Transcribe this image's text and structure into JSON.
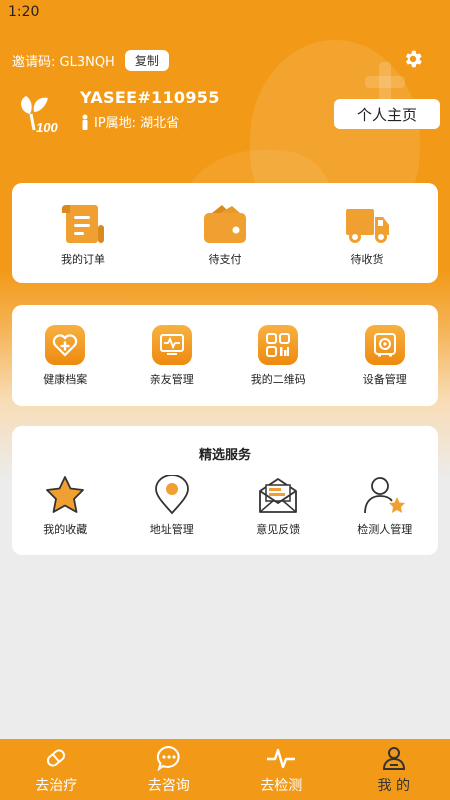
{
  "status_bar": {
    "time": "1:20"
  },
  "header": {
    "invite_code": "邀请码: GL3NQH",
    "copy_label": "复制",
    "username": "YASEE#110955",
    "ip_location": "IP属地: 湖北省",
    "homepage_label": "个人主页"
  },
  "orders": [
    {
      "label": "我的订单",
      "icon": "order-scroll-icon"
    },
    {
      "label": "待支付",
      "icon": "wallet-icon"
    },
    {
      "label": "待收货",
      "icon": "truck-icon"
    }
  ],
  "management": [
    {
      "label": "健康档案",
      "icon": "health-record-icon"
    },
    {
      "label": "亲友管理",
      "icon": "family-monitor-icon"
    },
    {
      "label": "我的二维码",
      "icon": "qr-code-icon"
    },
    {
      "label": "设备管理",
      "icon": "device-icon"
    }
  ],
  "services": {
    "title": "精选服务",
    "items": [
      {
        "label": "我的收藏",
        "icon": "star-icon"
      },
      {
        "label": "地址管理",
        "icon": "location-pin-icon"
      },
      {
        "label": "意见反馈",
        "icon": "feedback-envelope-icon"
      },
      {
        "label": "检测人管理",
        "icon": "tester-person-icon"
      }
    ]
  },
  "tabbar": [
    {
      "label": "去治疗",
      "icon": "pill-icon"
    },
    {
      "label": "去咨询",
      "icon": "chat-icon"
    },
    {
      "label": "去检测",
      "icon": "pulse-icon"
    },
    {
      "label": "我 的",
      "icon": "person-icon",
      "active": true
    }
  ],
  "colors": {
    "accent": "#f29a17",
    "icon_orange": "#f0a030",
    "background": "#ececec"
  }
}
